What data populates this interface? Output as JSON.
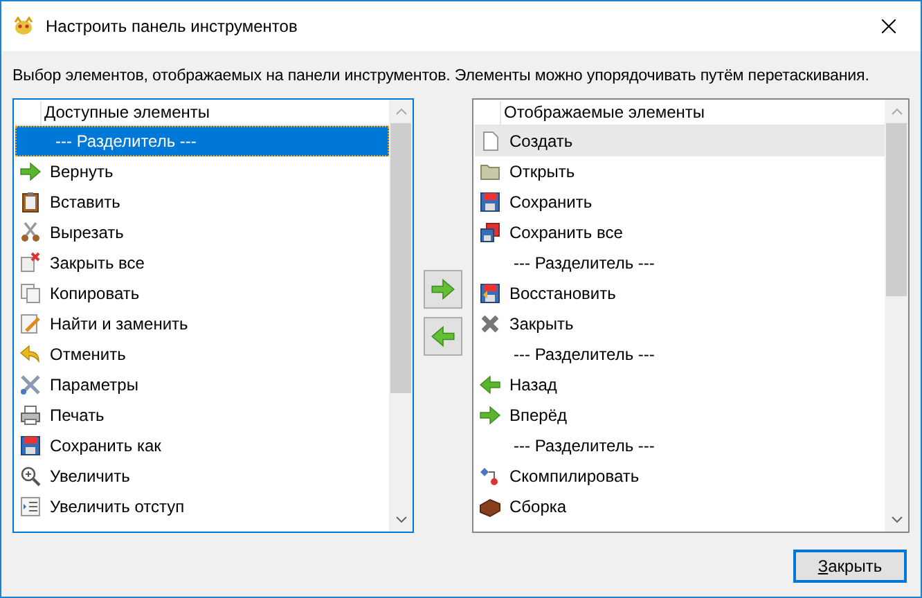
{
  "window": {
    "title": "Настроить панель инструментов"
  },
  "description": "Выбор элементов, отображаемых на панели инструментов. Элементы можно упорядочивать путём перетаскивания.",
  "available": {
    "header": "Доступные элементы",
    "focused": true,
    "items": [
      {
        "kind": "separator",
        "label": "--- Разделитель ---",
        "selected": true
      },
      {
        "kind": "command",
        "label": "Вернуть",
        "selected": false
      },
      {
        "kind": "command",
        "label": "Вставить",
        "selected": false
      },
      {
        "kind": "command",
        "label": "Вырезать",
        "selected": false
      },
      {
        "kind": "command",
        "label": "Закрыть все",
        "selected": false
      },
      {
        "kind": "command",
        "label": "Копировать",
        "selected": false
      },
      {
        "kind": "command",
        "label": "Найти и заменить",
        "selected": false
      },
      {
        "kind": "command",
        "label": "Отменить",
        "selected": false
      },
      {
        "kind": "command",
        "label": "Параметры",
        "selected": false
      },
      {
        "kind": "command",
        "label": "Печать",
        "selected": false
      },
      {
        "kind": "command",
        "label": "Сохранить как",
        "selected": false
      },
      {
        "kind": "command",
        "label": "Увеличить",
        "selected": false
      },
      {
        "kind": "command",
        "label": "Увеличить отступ",
        "selected": false
      }
    ]
  },
  "shown": {
    "header": "Отображаемые элементы",
    "focused": false,
    "items": [
      {
        "kind": "command",
        "label": "Создать",
        "selected": true
      },
      {
        "kind": "command",
        "label": "Открыть",
        "selected": false
      },
      {
        "kind": "command",
        "label": "Сохранить",
        "selected": false
      },
      {
        "kind": "command",
        "label": "Сохранить все",
        "selected": false
      },
      {
        "kind": "separator",
        "label": "--- Разделитель ---",
        "selected": false
      },
      {
        "kind": "command",
        "label": "Восстановить",
        "selected": false
      },
      {
        "kind": "command",
        "label": "Закрыть",
        "selected": false
      },
      {
        "kind": "separator",
        "label": "--- Разделитель ---",
        "selected": false
      },
      {
        "kind": "command",
        "label": "Назад",
        "selected": false
      },
      {
        "kind": "command",
        "label": "Вперёд",
        "selected": false
      },
      {
        "kind": "separator",
        "label": "--- Разделитель ---",
        "selected": false
      },
      {
        "kind": "command",
        "label": "Скомпилировать",
        "selected": false
      },
      {
        "kind": "command",
        "label": "Сборка",
        "selected": false
      }
    ]
  },
  "close_button": {
    "label": "Закрыть"
  }
}
